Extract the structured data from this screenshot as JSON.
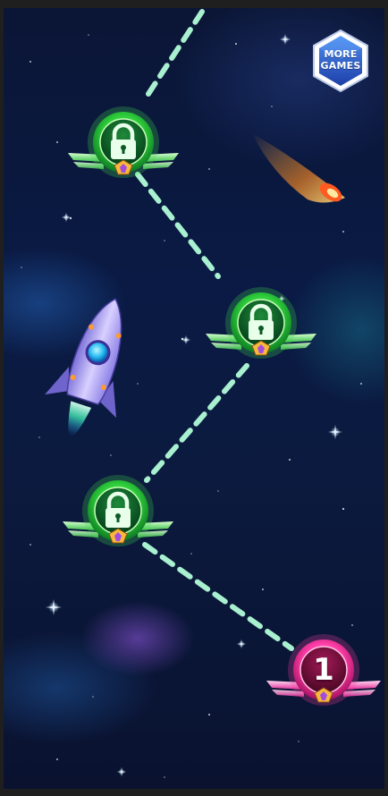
{
  "more_games": {
    "label_line1": "MORE",
    "label_line2": "GAMES",
    "icon": "more-games-hexagon-badge"
  },
  "levels": [
    {
      "number": "1",
      "state": "unlocked",
      "color": "#c8196e",
      "icon": "level-badge"
    },
    {
      "state": "locked",
      "color": "#1fa83a",
      "icon": "lock-icon"
    },
    {
      "state": "locked",
      "color": "#1fa83a",
      "icon": "lock-icon"
    },
    {
      "state": "locked",
      "color": "#1fa83a",
      "icon": "lock-icon"
    }
  ],
  "path_color": "#a8f0d0",
  "decorations": [
    "rocket",
    "comet",
    "stars",
    "nebula"
  ]
}
